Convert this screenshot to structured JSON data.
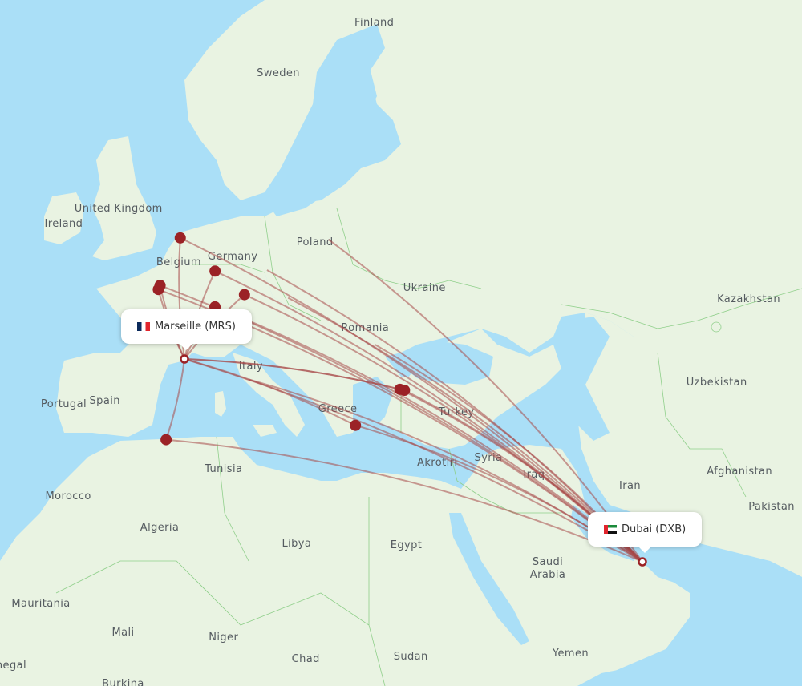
{
  "map": {
    "colors": {
      "water": "#aadff7",
      "land": "#e9f3e2",
      "border": "#8fcf8a",
      "route": "#a84848",
      "marker": "#9b2226",
      "hub_ring": "#9b2226"
    },
    "country_labels": [
      {
        "name": "Finland",
        "lon": 26.0,
        "lat": 64.5
      },
      {
        "name": "Sweden",
        "lon": 15.5,
        "lat": 62.0
      },
      {
        "name": "United Kingdom",
        "lon": -2.0,
        "lat": 54.2
      },
      {
        "name": "Ireland",
        "lon": -8.0,
        "lat": 53.2
      },
      {
        "name": "Poland",
        "lon": 19.5,
        "lat": 52.0
      },
      {
        "name": "Germany",
        "lon": 10.5,
        "lat": 51.0
      },
      {
        "name": "Belgium",
        "lon": 4.6,
        "lat": 50.6
      },
      {
        "name": "Ukraine",
        "lon": 31.5,
        "lat": 48.8
      },
      {
        "name": "Kazakhstan",
        "lon": 67.0,
        "lat": 48.0
      },
      {
        "name": "Romania",
        "lon": 25.0,
        "lat": 45.8
      },
      {
        "name": "Italy",
        "lon": 12.5,
        "lat": 42.8
      },
      {
        "name": "Uzbekistan",
        "lon": 63.5,
        "lat": 41.5
      },
      {
        "name": "Spain",
        "lon": -3.5,
        "lat": 40.0
      },
      {
        "name": "Portugal",
        "lon": -8.0,
        "lat": 39.7
      },
      {
        "name": "Greece",
        "lon": 22.0,
        "lat": 39.3
      },
      {
        "name": "Turkey",
        "lon": 35.0,
        "lat": 39.0
      },
      {
        "name": "Syria",
        "lon": 38.5,
        "lat": 35.0
      },
      {
        "name": "Akrotiri",
        "lon": 32.9,
        "lat": 34.6
      },
      {
        "name": "Iraq",
        "lon": 43.5,
        "lat": 33.5
      },
      {
        "name": "Afghanistan",
        "lon": 66.0,
        "lat": 33.8
      },
      {
        "name": "Tunisia",
        "lon": 9.5,
        "lat": 34.0
      },
      {
        "name": "Iran",
        "lon": 54.0,
        "lat": 32.5
      },
      {
        "name": "Pakistan",
        "lon": 69.5,
        "lat": 30.5
      },
      {
        "name": "Morocco",
        "lon": -7.5,
        "lat": 31.5
      },
      {
        "name": "Algeria",
        "lon": 2.5,
        "lat": 28.5
      },
      {
        "name": "Libya",
        "lon": 17.5,
        "lat": 27.0
      },
      {
        "name": "Egypt",
        "lon": 29.5,
        "lat": 26.8
      },
      {
        "name": "Saudi\nArabia",
        "lon": 45.0,
        "lat": 24.5
      },
      {
        "name": "Mauritania",
        "lon": -10.5,
        "lat": 21.0
      },
      {
        "name": "Mali",
        "lon": -1.5,
        "lat": 18.0
      },
      {
        "name": "Niger",
        "lon": 9.5,
        "lat": 17.5
      },
      {
        "name": "Chad",
        "lon": 18.5,
        "lat": 15.2
      },
      {
        "name": "Sudan",
        "lon": 30.0,
        "lat": 15.5
      },
      {
        "name": "Yemen",
        "lon": 47.5,
        "lat": 15.8
      },
      {
        "name": "Senegal",
        "lon": -14.5,
        "lat": 14.5
      },
      {
        "name": "Burkina",
        "lon": -1.5,
        "lat": 12.6
      }
    ],
    "origin": {
      "city": "Marseille",
      "code": "MRS",
      "label": "Marseille (MRS)",
      "country_flag": "flag-france-icon",
      "lon": 5.22,
      "lat": 43.44
    },
    "destination": {
      "city": "Dubai",
      "code": "DXB",
      "label": "Dubai (DXB)",
      "country_flag": "flag-uae-icon",
      "lon": 55.36,
      "lat": 25.25
    },
    "via_airports": [
      {
        "lon": 4.76,
        "lat": 52.31
      },
      {
        "lon": 2.55,
        "lat": 49.01
      },
      {
        "lon": 2.36,
        "lat": 48.72
      },
      {
        "lon": 8.57,
        "lat": 50.03
      },
      {
        "lon": 11.79,
        "lat": 48.35
      },
      {
        "lon": 8.56,
        "lat": 47.45
      },
      {
        "lon": 28.81,
        "lat": 40.98
      },
      {
        "lon": 29.31,
        "lat": 40.9
      },
      {
        "lon": 23.94,
        "lat": 37.94
      },
      {
        "lon": 3.21,
        "lat": 36.69
      }
    ],
    "direct_routes_to_destination": [
      {
        "lon": 16.57,
        "lat": 48.11
      },
      {
        "lon": 14.26,
        "lat": 50.1
      },
      {
        "lon": 21.0,
        "lat": 52.2
      },
      {
        "lon": 26.1,
        "lat": 44.57
      },
      {
        "lon": 12.25,
        "lat": 41.8
      }
    ]
  }
}
